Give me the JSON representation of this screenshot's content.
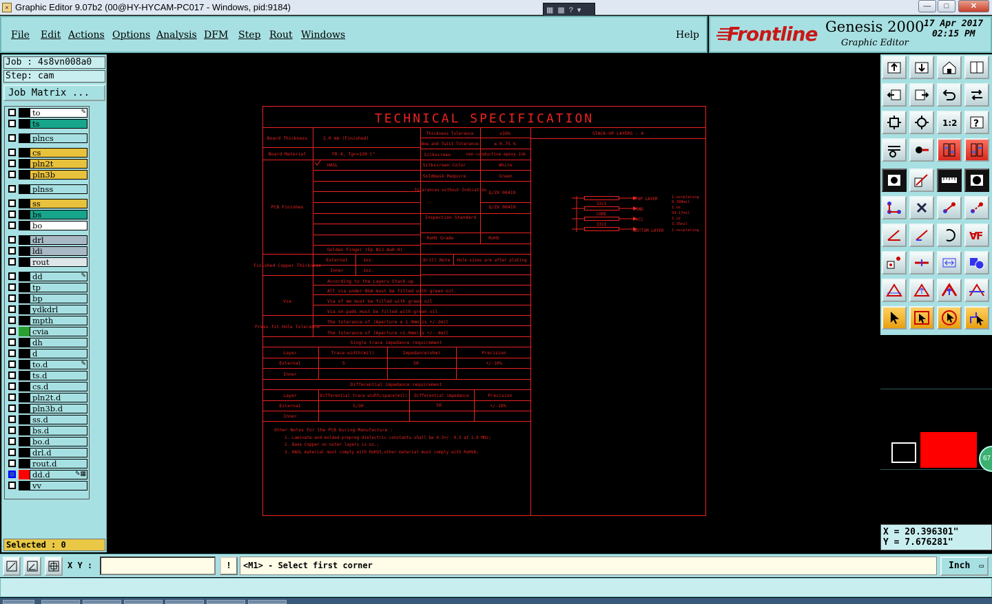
{
  "window": {
    "title": "Graphic Editor 9.07b2 (00@HY-HYCAM-PC017 - Windows, pid:9184)",
    "minimize": "—",
    "maximize": "□",
    "close": "✕"
  },
  "menu": {
    "items": [
      "File",
      "Edit",
      "Actions",
      "Options",
      "Analysis",
      "DFM",
      "Step",
      "Rout",
      "Windows"
    ],
    "help": "Help"
  },
  "brand": {
    "logo": "Frontline",
    "product": "Genesis 2000",
    "subtitle": "Graphic Editor",
    "date": "17 Apr 2017",
    "time": "02:15 PM"
  },
  "left": {
    "job": "Job : 4s8vn008a0",
    "step": "Step: cam",
    "job_matrix": "Job Matrix ...",
    "selected": "Selected : 0",
    "layers": [
      {
        "name": "to",
        "color": "#ffffff",
        "mark": "✎"
      },
      {
        "name": "ts",
        "color": "#17a58c",
        "mark": ""
      },
      {
        "name": "plncs",
        "color": "#a7e0e2",
        "mark": ""
      },
      {
        "name": "cs",
        "color": "#e8c23c",
        "mark": ""
      },
      {
        "name": "pln2t",
        "color": "#e8c23c",
        "mark": ""
      },
      {
        "name": "pln3b",
        "color": "#e8c23c",
        "mark": ""
      },
      {
        "name": "plnss",
        "color": "#a7e0e2",
        "mark": ""
      },
      {
        "name": "ss",
        "color": "#e8c23c",
        "mark": ""
      },
      {
        "name": "bs",
        "color": "#17a58c",
        "mark": ""
      },
      {
        "name": "bo",
        "color": "#ffffff",
        "mark": ""
      },
      {
        "name": "drl",
        "color": "#a8b8c4",
        "mark": ""
      },
      {
        "name": "ldi",
        "color": "#a8b8c4",
        "mark": ""
      },
      {
        "name": "rout",
        "color": "#dfe6ea",
        "mark": ""
      },
      {
        "name": "dd",
        "color": "#a7e0e2",
        "mark": "✎"
      },
      {
        "name": "tp",
        "color": "#a7e0e2",
        "mark": ""
      },
      {
        "name": "bp",
        "color": "#a7e0e2",
        "mark": ""
      },
      {
        "name": "ydkdrl",
        "color": "#a7e0e2",
        "mark": ""
      },
      {
        "name": "mpth",
        "color": "#a7e0e2",
        "mark": ""
      },
      {
        "name": "cvia",
        "color": "#a7e0e2",
        "mark": ""
      },
      {
        "name": "dh",
        "color": "#a7e0e2",
        "mark": ""
      },
      {
        "name": "d",
        "color": "#a7e0e2",
        "mark": ""
      },
      {
        "name": "to.d",
        "color": "#a7e0e2",
        "mark": "✎"
      },
      {
        "name": "ts.d",
        "color": "#a7e0e2",
        "mark": ""
      },
      {
        "name": "cs.d",
        "color": "#a7e0e2",
        "mark": ""
      },
      {
        "name": "pln2t.d",
        "color": "#a7e0e2",
        "mark": ""
      },
      {
        "name": "pln3b.d",
        "color": "#a7e0e2",
        "mark": ""
      },
      {
        "name": "ss.d",
        "color": "#a7e0e2",
        "mark": ""
      },
      {
        "name": "bs.d",
        "color": "#a7e0e2",
        "mark": ""
      },
      {
        "name": "bo.d",
        "color": "#a7e0e2",
        "mark": ""
      },
      {
        "name": "drl.d",
        "color": "#a7e0e2",
        "mark": ""
      },
      {
        "name": "rout.d",
        "color": "#a7e0e2",
        "mark": ""
      },
      {
        "name": "dd.d",
        "color": "#a7e0e2",
        "mark": "✎▦"
      },
      {
        "name": "vv",
        "color": "#a7e0e2",
        "mark": ""
      }
    ]
  },
  "spec": {
    "title": "TECHNICAL SPECIFICATION",
    "board_thickness_label": "Board Thickness",
    "board_thickness": "2.0 mm   (Finished)",
    "board_material_label": "Board Material",
    "board_material": "FR-4, Tg>=130 C°",
    "pcb_finishes_label": "PCB Finishes",
    "hasl": "HASL",
    "golden_finger": "Golden Finger (Ep.Ni3.Au0.0)",
    "thickness_tolerance_label": "Thickness Tolerance",
    "thickness_tolerance": "±10%",
    "bow_twist_label": "Bow and Twist Tolerance",
    "bow_twist": "≤ 0.75 %",
    "silkscreen_label": "Silkscreen",
    "silkscreen": "non-conductive epoxy ink",
    "silkscreen_color_label": "Silkscreen Color",
    "silkscreen_color": "White",
    "soldermask_label": "Soldmask Require",
    "soldermask": "Green",
    "tolerance_label": "Tolerances without Indication",
    "tolerance_1": "Q/ZX 00419",
    "tolerance_2": "Q/ZX 00419",
    "inspection_label": "Inspection Standard",
    "rohs_label": "RoHS Grade",
    "rohs": "RoHS",
    "finished_copper_label": "Finished Copper Thickness",
    "external_label": "External",
    "inner_label": "Inner",
    "copper_ext": "1oz.",
    "copper_inner": "1oz.",
    "drill_note_label": "Drill Note",
    "drill_note": "Hole sizes are after plating",
    "stackup_note": "According to the Layers Stack-up",
    "via_label": "Via",
    "via_1": "All via under BGA must be filled with green oil.",
    "via_2": "Via of      mm must be filled with green oil",
    "via_3": "Via on pads must be filled with green oil",
    "press_fit_label": "Press-fit Hole Tolerance",
    "press_fit_1": "The tolerance of   (Aperture ≤ 1.0mm)is +/-2mil",
    "press_fit_2": "The tolerance of   (Aperture >1.0mm)is +/- 4mil",
    "single_imp_title": "Single trace impedance requirement",
    "single_headers": [
      "Layer",
      "Trace width(mil)",
      "Impedance(ohm)",
      "Precision"
    ],
    "single_rows": [
      [
        "External",
        "5",
        "50",
        "+/-10%"
      ],
      [
        "Inner",
        "",
        "",
        ""
      ]
    ],
    "diff_imp_title": "Differential impedance requirement",
    "diff_headers": [
      "Layer",
      "Differential trace width/space(mil)",
      "Differential impedance",
      "Precision"
    ],
    "diff_rows": [
      [
        "External",
        "5/30",
        "50",
        "+/-10%"
      ],
      [
        "Inner",
        "",
        "",
        ""
      ]
    ],
    "notes_title": "Other Notes For the PCB During Manufacture :",
    "notes": [
      "1. Laminate and molded prepreg dielectric constants shall be 4.3+/- 0.3 at 1.0 MHz;",
      "2. Base Copper on outer layers is    oz.;",
      "3. HASL material must comply with RoHS5,other material must comply with RoHS6;"
    ],
    "stackup_title": "STACK-UP LAYERS : 4",
    "stack_layers": [
      "TOP LAYER",
      "GND",
      "VCC",
      "BOTTOM LAYER"
    ],
    "stack_cores": [
      "3313",
      "CORE",
      "3313"
    ],
    "stack_notes": [
      "1.oz+plating",
      "0.398mil",
      "1.oz",
      "54.17mil",
      "1.oz",
      "3.35mil",
      "1.oz+plating"
    ]
  },
  "right": {
    "coord_x": "X = 20.396301\"",
    "coord_y": "Y = 7.676281\"",
    "badge": "67"
  },
  "bottom": {
    "xy_label": "X Y :",
    "xy_value": "",
    "prompt": "<M1> - Select first corner",
    "prompt_icon": "!",
    "units": "Inch"
  },
  "colors": {
    "panel": "#a7e0e2",
    "drawing": "#e22222",
    "accent_red": "#ff0000"
  }
}
